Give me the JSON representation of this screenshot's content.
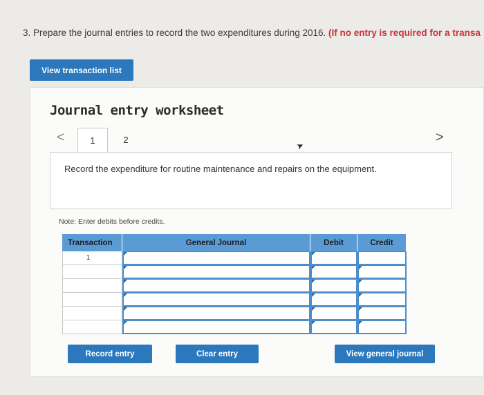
{
  "question": {
    "prefix": "3. Prepare the journal entries to record the two expenditures during 2016.",
    "required": "(If no entry is required for a transa"
  },
  "view_transaction_list_label": "View transaction list",
  "worksheet": {
    "title": "Journal entry worksheet",
    "prev_glyph": "<",
    "next_glyph": ">",
    "tabs": [
      "1",
      "2"
    ],
    "active_tab": "1",
    "description": "Record the expenditure for routine maintenance and repairs on the equipment.",
    "note": "Note: Enter debits before credits."
  },
  "journal": {
    "headers": [
      "Transaction",
      "General Journal",
      "Debit",
      "Credit"
    ],
    "rows": [
      {
        "transaction": "1",
        "account": "",
        "debit": "",
        "credit": ""
      },
      {
        "transaction": "",
        "account": "",
        "debit": "",
        "credit": ""
      },
      {
        "transaction": "",
        "account": "",
        "debit": "",
        "credit": ""
      },
      {
        "transaction": "",
        "account": "",
        "debit": "",
        "credit": ""
      },
      {
        "transaction": "",
        "account": "",
        "debit": "",
        "credit": ""
      },
      {
        "transaction": "",
        "account": "",
        "debit": "",
        "credit": ""
      }
    ]
  },
  "buttons": {
    "record": "Record entry",
    "clear": "Clear entry",
    "view_general_journal": "View general journal"
  },
  "colors": {
    "accent": "#2b78bd",
    "header": "#5b9bd5",
    "required_text": "#c9323a"
  }
}
